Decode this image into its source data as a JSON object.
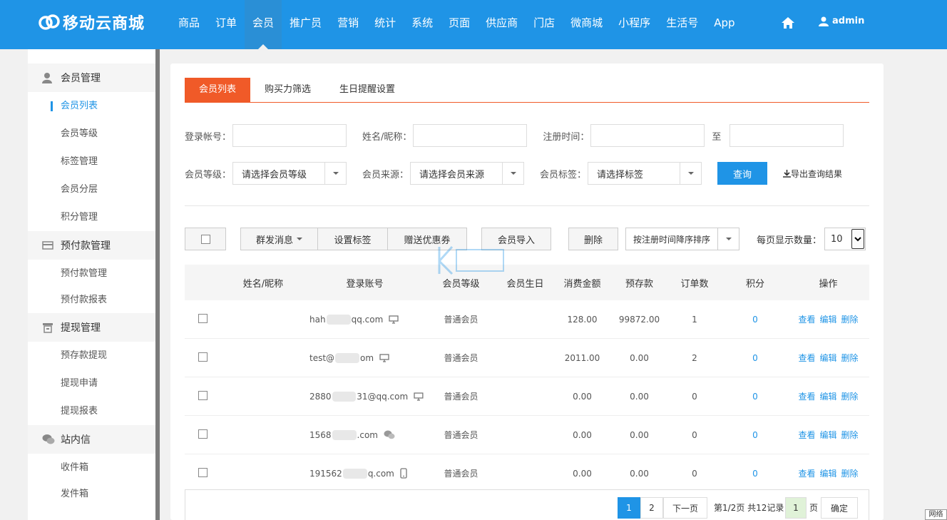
{
  "brand": {
    "name": "移动云商城"
  },
  "topnav": {
    "items": [
      "商品",
      "订单",
      "会员",
      "推广员",
      "营销",
      "统计",
      "系统",
      "页面",
      "供应商",
      "门店",
      "微商城",
      "小程序",
      "生活号",
      "App"
    ],
    "active_index": 2,
    "user": "admin"
  },
  "sidebar": {
    "groups": [
      {
        "title": "会员管理",
        "icon": "user-icon",
        "items": [
          "会员列表",
          "会员等级",
          "标签管理",
          "会员分层",
          "积分管理"
        ]
      },
      {
        "title": "预付款管理",
        "icon": "card-icon",
        "items": [
          "预付款管理",
          "预付款报表"
        ]
      },
      {
        "title": "提现管理",
        "icon": "withdraw-icon",
        "items": [
          "预存款提现",
          "提现申请",
          "提现报表"
        ]
      },
      {
        "title": "站内信",
        "icon": "chat-icon",
        "items": [
          "收件箱",
          "发件箱"
        ]
      }
    ],
    "active_item": "会员列表"
  },
  "tabs": [
    "会员列表",
    "购买力筛选",
    "生日提醒设置"
  ],
  "filters": {
    "login_label": "登录帐号：",
    "name_label": "姓名/昵称：",
    "reg_time_label": "注册时间：",
    "to_label": "至",
    "level_label": "会员等级：",
    "level_value": "请选择会员等级",
    "source_label": "会员来源：",
    "source_value": "请选择会员来源",
    "tag_label": "会员标签：",
    "tag_value": "请选择标签",
    "query_button": "查询",
    "export_link": "导出查询结果"
  },
  "toolbar": {
    "group_msg": "群发消息",
    "set_tag": "设置标签",
    "give_coupon": "赠送优惠券",
    "import": "会员导入",
    "delete": "删除",
    "sort": "按注册时间降序排序",
    "perpage_label": "每页显示数量：",
    "perpage_value": "10"
  },
  "table": {
    "headers": [
      "姓名/昵称",
      "登录账号",
      "会员等级",
      "会员生日",
      "消费金额",
      "预存款",
      "订单数",
      "积分",
      "操作"
    ],
    "rows": [
      {
        "name": "",
        "acct_pre": "hah",
        "acct_post": "qq.com",
        "device": "desktop",
        "level": "普通会员",
        "birthday": "",
        "spend": "128.00",
        "deposit": "99872.00",
        "orders": "1",
        "points": "0"
      },
      {
        "name": "",
        "acct_pre": "test@",
        "acct_post": "om",
        "device": "desktop",
        "level": "普通会员",
        "birthday": "",
        "spend": "2011.00",
        "deposit": "0.00",
        "orders": "2",
        "points": "0"
      },
      {
        "name": "",
        "acct_pre": "2880",
        "acct_post": "31@qq.com",
        "device": "desktop",
        "level": "普通会员",
        "birthday": "",
        "spend": "0.00",
        "deposit": "0.00",
        "orders": "0",
        "points": "0"
      },
      {
        "name": "",
        "acct_pre": "1568",
        "acct_post": ".com",
        "device": "wechat",
        "level": "普通会员",
        "birthday": "",
        "spend": "0.00",
        "deposit": "0.00",
        "orders": "0",
        "points": "0"
      },
      {
        "name": "",
        "acct_pre": "191562",
        "acct_post": "q.com",
        "device": "mobile",
        "level": "普通会员",
        "birthday": "",
        "spend": "0.00",
        "deposit": "0.00",
        "orders": "0",
        "points": "0"
      }
    ],
    "ops": [
      "查看",
      "编辑",
      "删除"
    ]
  },
  "pager": {
    "page1": "1",
    "page2": "2",
    "next": "下一页",
    "summary": "第1/2页 共12记录",
    "jump_value": "1",
    "page_unit": "页",
    "confirm": "确定"
  },
  "corner_tag": "网络"
}
